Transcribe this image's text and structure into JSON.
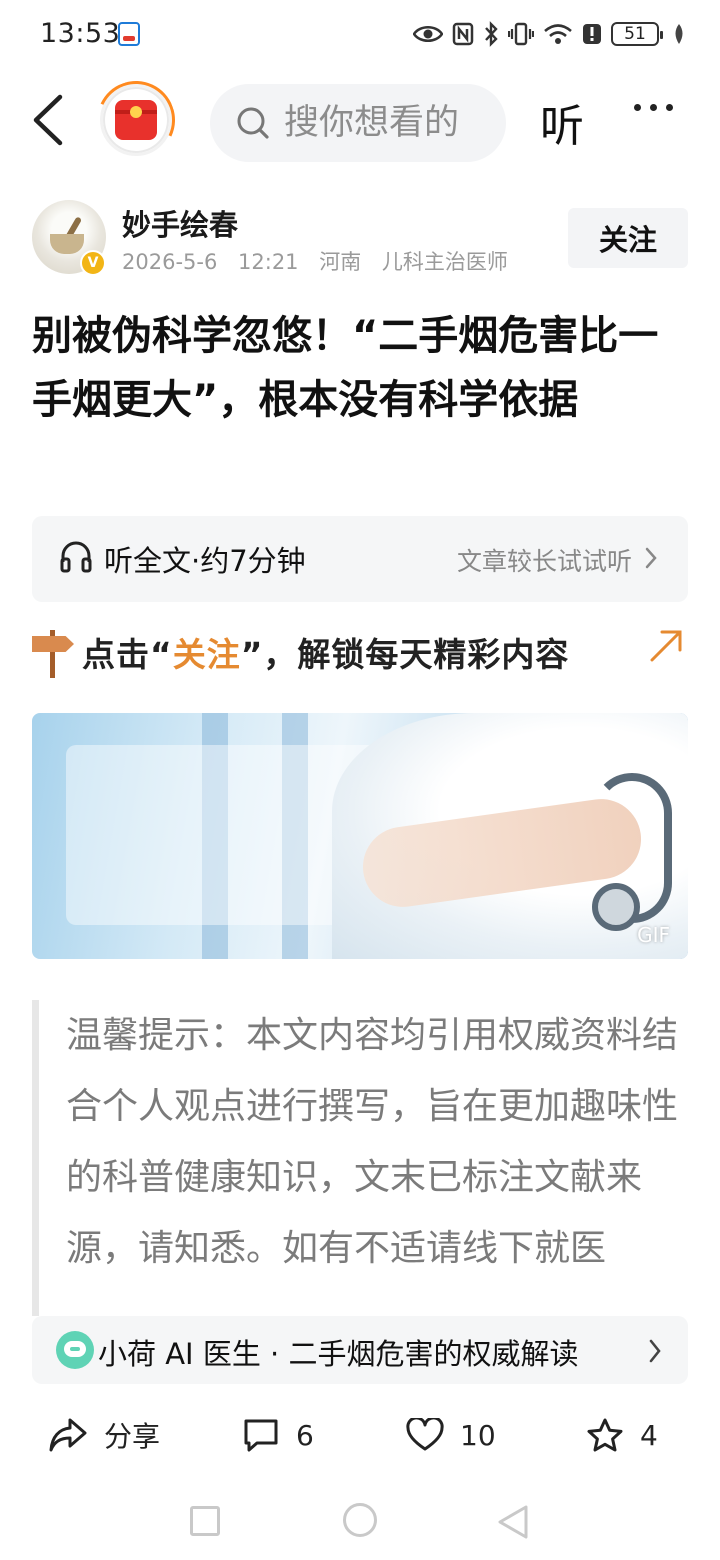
{
  "status_bar": {
    "time": "13:53",
    "battery": "51",
    "icons": [
      "eye-icon",
      "nfc-icon",
      "bluetooth-icon",
      "vibrate-icon",
      "wifi-icon",
      "alert-icon",
      "battery-icon",
      "leaf-icon"
    ]
  },
  "nav": {
    "search_placeholder": "搜你想看的",
    "listen_label": "听"
  },
  "author": {
    "name": "妙手绘春",
    "date": "2026-5-6",
    "time": "12:21",
    "location": "河南",
    "title": "儿科主治医师",
    "verified_mark": "V",
    "follow_label": "关注"
  },
  "article": {
    "title": "别被伪科学忽悠！“二手烟危害比一手烟更大”，根本没有科学依据"
  },
  "listen_bar": {
    "label": "听全文·约7分钟",
    "hint": "文章较长试试听"
  },
  "banner": {
    "prefix": "点击“",
    "highlight": "关注",
    "suffix": "”，解锁每天精彩内容"
  },
  "hero": {
    "badge": "GIF"
  },
  "tip": {
    "text": "温馨提示：本文内容均引用权威资料结合个人观点进行撰写，旨在更加趣味性的科普健康知识，文末已标注文献来源，请知悉。如有不适请线下就医"
  },
  "ai_bar": {
    "text": "小荷 AI 医生 · 二手烟危害的权威解读"
  },
  "actions": {
    "share_label": "分享",
    "comments_count": "6",
    "likes_count": "10",
    "favorites_count": "4"
  },
  "colors": {
    "accent_orange": "#e58a31",
    "redpack": "#e8312c",
    "verified": "#f2b516",
    "ai_green": "#5fd3b5"
  }
}
